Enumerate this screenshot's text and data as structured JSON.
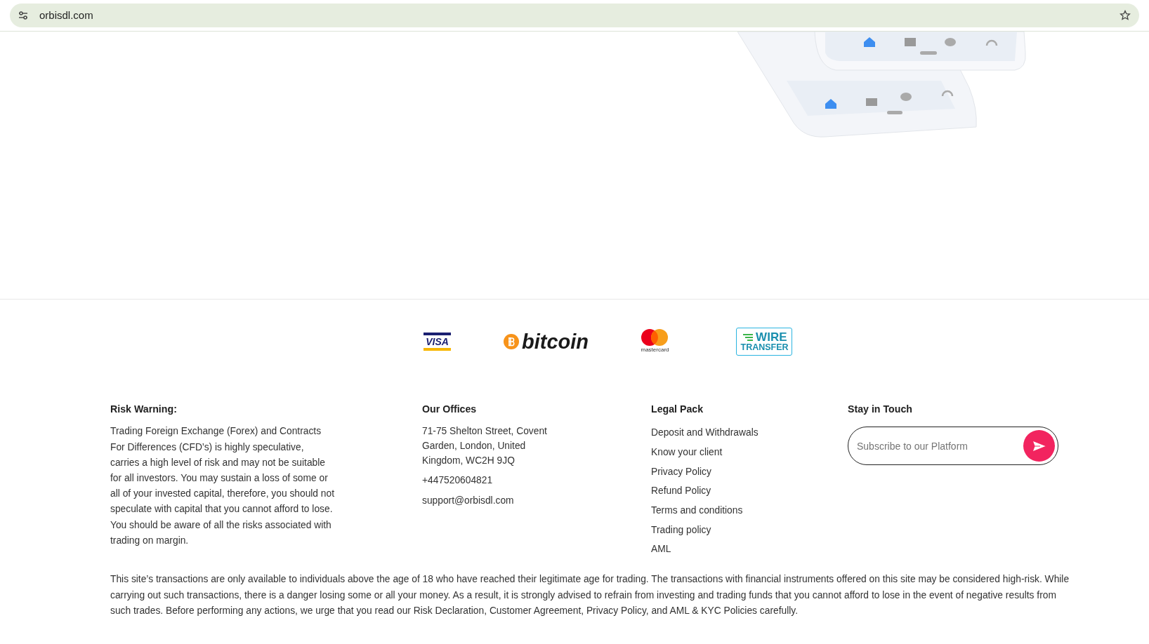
{
  "browser": {
    "address": "orbisdl.com"
  },
  "payment_logos": [
    {
      "kind": "visa",
      "text": "VISA"
    },
    {
      "kind": "bitcoin",
      "text": "bitcoin"
    },
    {
      "kind": "mastercard",
      "text": "mastercard"
    },
    {
      "kind": "wire",
      "lines": [
        "WIRE",
        "TRANSFER"
      ]
    }
  ],
  "risk_warning": {
    "title": "Risk Warning:",
    "text": "Trading Foreign Exchange (Forex) and Contracts For Differences (CFD’s) is highly speculative, carries a high level of risk and may not be suitable for all investors. You may sustain a loss of some or all of your invested capital, therefore, you should not speculate with capital that you cannot afford to lose. You should be aware of all the risks associated with trading on margin."
  },
  "offices": {
    "title": "Our Offices",
    "address": "71-75 Shelton Street, Covent Garden, London, United Kingdom, WC2H 9JQ",
    "phone": "+447520604821",
    "email": "support@orbisdl.com"
  },
  "legal_pack": {
    "title": "Legal Pack",
    "links": [
      "Deposit and Withdrawals",
      "Know your client",
      "Privacy Policy",
      "Refund Policy",
      "Terms and conditions",
      "Trading policy",
      "AML"
    ]
  },
  "stay_in_touch": {
    "title": "Stay in Touch",
    "placeholder": "Subscribe to our Platform"
  },
  "disclaimer": "This site’s transactions are only available to individuals above the age of 18 who have reached their legitimate age for trading. The transactions with financial instruments offered on this site may be considered high-risk. While carrying out such transactions, there is a danger losing some or all your money. As a result, it is strongly advised to refrain from investing and trading funds that you cannot afford to lose in the event of negative results from such trades. Before performing any actions, we urge that you read our Risk Declaration, Customer Agreement, Privacy Policy, and AML & KYC Policies carefully."
}
